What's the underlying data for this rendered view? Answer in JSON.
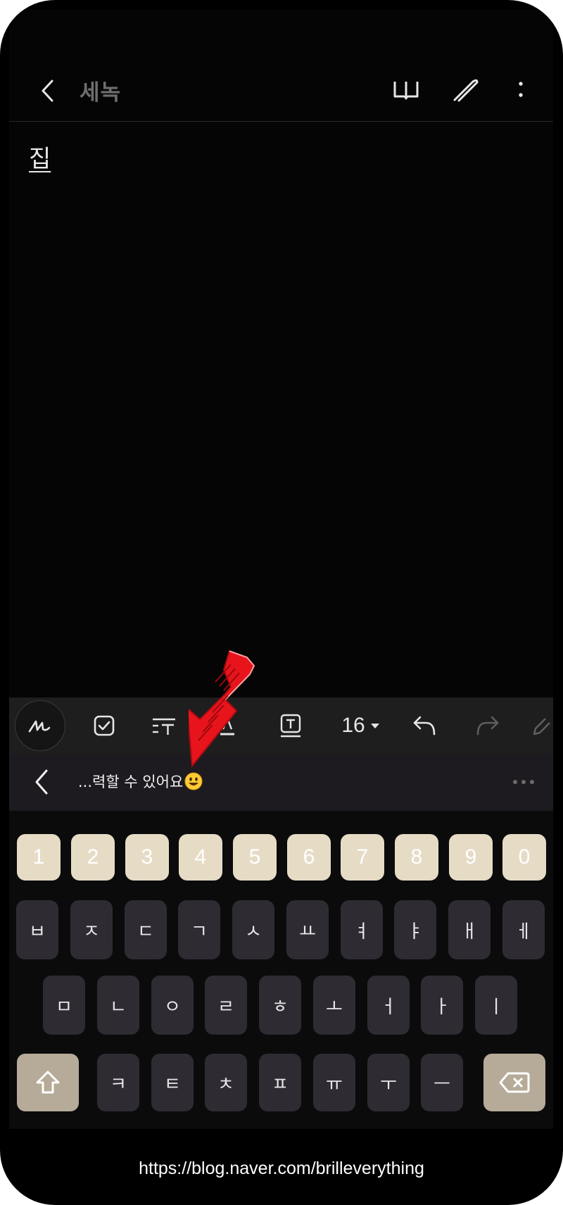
{
  "header": {
    "title": "세녹",
    "icons": [
      "back-icon",
      "book-icon",
      "pen-icon",
      "more-vertical-icon"
    ]
  },
  "note": {
    "text": "집"
  },
  "toolbar": {
    "font_size": "16",
    "icons": [
      "handwriting-icon",
      "checkbox-icon",
      "text-style-icon",
      "font-color-icon",
      "text-background-icon",
      "dropdown-caret-icon",
      "undo-icon",
      "redo-icon",
      "eraser-icon"
    ]
  },
  "suggestion": {
    "text": "...력할 수 있어요",
    "emoji": "smiling-face-emoji",
    "icons": [
      "back-icon",
      "more-horizontal-icon"
    ]
  },
  "keyboard": {
    "numbers": [
      "1",
      "2",
      "3",
      "4",
      "5",
      "6",
      "7",
      "8",
      "9",
      "0"
    ],
    "row1": [
      "ㅂ",
      "ㅈ",
      "ㄷ",
      "ㄱ",
      "ㅅ",
      "ㅛ",
      "ㅕ",
      "ㅑ",
      "ㅐ",
      "ㅔ"
    ],
    "row2": [
      "ㅁ",
      "ㄴ",
      "ㅇ",
      "ㄹ",
      "ㅎ",
      "ㅗ",
      "ㅓ",
      "ㅏ",
      "ㅣ"
    ],
    "row3": [
      "ㅋ",
      "ㅌ",
      "ㅊ",
      "ㅍ",
      "ㅠ",
      "ㅜ",
      "ㅡ"
    ],
    "icons": [
      "shift-icon",
      "backspace-icon"
    ],
    "colors": {
      "number_key": "#e6dcc6",
      "letter_key": "#2e2b33",
      "function_key": "#b5ab98"
    }
  },
  "footer": {
    "url": "https://blog.naver.com/brilleverything"
  },
  "annotation": {
    "icon": "red-arrow-icon",
    "color": "#e8141c"
  }
}
